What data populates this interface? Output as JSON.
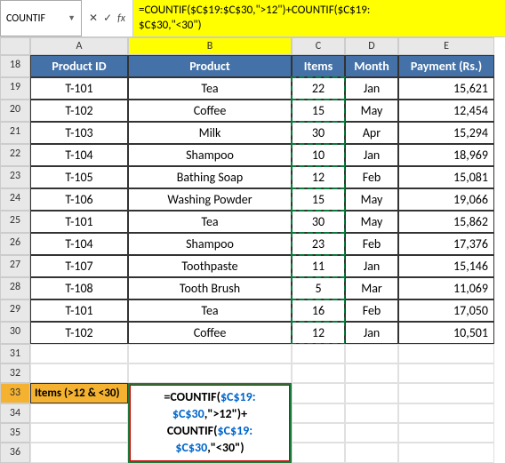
{
  "nameBox": "COUNTIF",
  "formulaBar": {
    "line1": "=COUNTIF($C$19:$C$30,\">12\")+COUNTIF($C$19:",
    "line2": "$C$30,\"<30\")"
  },
  "columns": [
    "A",
    "B",
    "C",
    "D",
    "E"
  ],
  "rows": [
    "18",
    "19",
    "20",
    "21",
    "22",
    "23",
    "24",
    "25",
    "26",
    "27",
    "28",
    "29",
    "30",
    "31",
    "32",
    "33",
    "34",
    "35",
    "36"
  ],
  "headers": {
    "A": "Product ID",
    "B": "Product",
    "C": "Items",
    "D": "Month",
    "E": "Payment (Rs.)"
  },
  "data": [
    {
      "id": "T-101",
      "prod": "Tea",
      "items": "22",
      "mon": "Jan",
      "pay": "15,621"
    },
    {
      "id": "T-102",
      "prod": "Coffee",
      "items": "15",
      "mon": "May",
      "pay": "12,454"
    },
    {
      "id": "T-103",
      "prod": "Milk",
      "items": "30",
      "mon": "Apr",
      "pay": "15,294"
    },
    {
      "id": "T-104",
      "prod": "Shampoo",
      "items": "10",
      "mon": "Jan",
      "pay": "18,969"
    },
    {
      "id": "T-105",
      "prod": "Bathing Soap",
      "items": "12",
      "mon": "Feb",
      "pay": "15,081"
    },
    {
      "id": "T-106",
      "prod": "Washing Powder",
      "items": "15",
      "mon": "May",
      "pay": "19,066"
    },
    {
      "id": "T-101",
      "prod": "Tea",
      "items": "30",
      "mon": "May",
      "pay": "15,862"
    },
    {
      "id": "T-104",
      "prod": "Shampoo",
      "items": "23",
      "mon": "Feb",
      "pay": "17,376"
    },
    {
      "id": "T-107",
      "prod": "Toothpaste",
      "items": "11",
      "mon": "Jan",
      "pay": "15,146"
    },
    {
      "id": "T-108",
      "prod": "Tooth Brush",
      "items": "5",
      "mon": "Mar",
      "pay": "11,069"
    },
    {
      "id": "T-101",
      "prod": "Tea",
      "items": "16",
      "mon": "Feb",
      "pay": "17,050"
    },
    {
      "id": "T-102",
      "prod": "Coffee",
      "items": "12",
      "mon": "Jan",
      "pay": "10,501"
    }
  ],
  "itemsLabel": "Items (>12 & <30)",
  "formulaDisplay": {
    "p1": "=COUNTIF(",
    "ref1": "$C$19:",
    "ref2": "$C$30",
    "p2": ",\">12\")+",
    "p3": "COUNTIF(",
    "ref3": "$C$19:",
    "ref4": "$C$30",
    "p4": ",\"<30\")"
  }
}
